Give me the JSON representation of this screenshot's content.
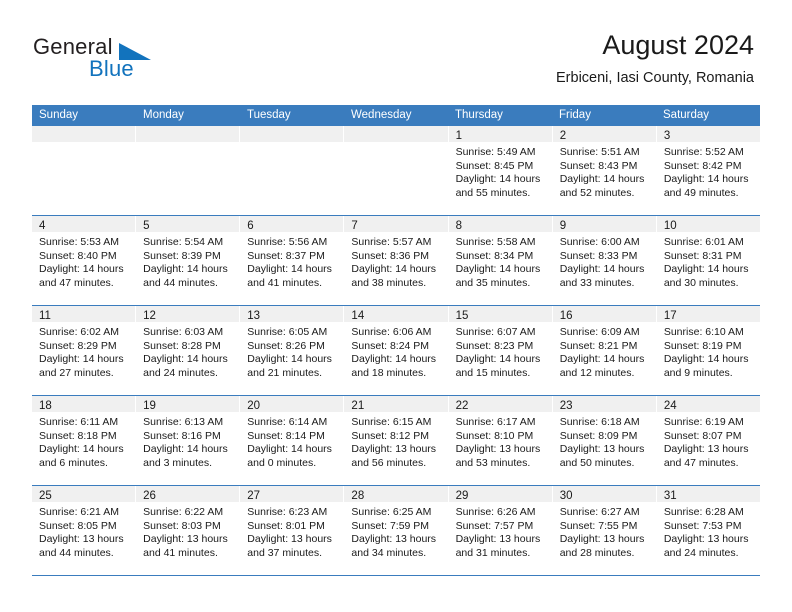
{
  "brand": {
    "name_part1": "General",
    "name_part2": "Blue",
    "triangle_color": "#1273bd"
  },
  "header": {
    "title": "August 2024",
    "subtitle": "Erbiceni, Iasi County, Romania"
  },
  "theme": {
    "header_blue": "#3a7cbe",
    "band_gray": "#f0f0f0",
    "text": "#1a1a1a"
  },
  "weekday_headers": [
    "Sunday",
    "Monday",
    "Tuesday",
    "Wednesday",
    "Thursday",
    "Friday",
    "Saturday"
  ],
  "labels": {
    "sunrise_prefix": "Sunrise: ",
    "sunset_prefix": "Sunset: ",
    "daylight_prefix": "Daylight: "
  },
  "weeks": [
    [
      {
        "day": "",
        "empty": true
      },
      {
        "day": "",
        "empty": true
      },
      {
        "day": "",
        "empty": true
      },
      {
        "day": "",
        "empty": true
      },
      {
        "day": "1",
        "sunrise": "Sunrise: 5:49 AM",
        "sunset": "Sunset: 8:45 PM",
        "daylight_line1": "Daylight: 14 hours",
        "daylight_line2": "and 55 minutes."
      },
      {
        "day": "2",
        "sunrise": "Sunrise: 5:51 AM",
        "sunset": "Sunset: 8:43 PM",
        "daylight_line1": "Daylight: 14 hours",
        "daylight_line2": "and 52 minutes."
      },
      {
        "day": "3",
        "sunrise": "Sunrise: 5:52 AM",
        "sunset": "Sunset: 8:42 PM",
        "daylight_line1": "Daylight: 14 hours",
        "daylight_line2": "and 49 minutes."
      }
    ],
    [
      {
        "day": "4",
        "sunrise": "Sunrise: 5:53 AM",
        "sunset": "Sunset: 8:40 PM",
        "daylight_line1": "Daylight: 14 hours",
        "daylight_line2": "and 47 minutes."
      },
      {
        "day": "5",
        "sunrise": "Sunrise: 5:54 AM",
        "sunset": "Sunset: 8:39 PM",
        "daylight_line1": "Daylight: 14 hours",
        "daylight_line2": "and 44 minutes."
      },
      {
        "day": "6",
        "sunrise": "Sunrise: 5:56 AM",
        "sunset": "Sunset: 8:37 PM",
        "daylight_line1": "Daylight: 14 hours",
        "daylight_line2": "and 41 minutes."
      },
      {
        "day": "7",
        "sunrise": "Sunrise: 5:57 AM",
        "sunset": "Sunset: 8:36 PM",
        "daylight_line1": "Daylight: 14 hours",
        "daylight_line2": "and 38 minutes."
      },
      {
        "day": "8",
        "sunrise": "Sunrise: 5:58 AM",
        "sunset": "Sunset: 8:34 PM",
        "daylight_line1": "Daylight: 14 hours",
        "daylight_line2": "and 35 minutes."
      },
      {
        "day": "9",
        "sunrise": "Sunrise: 6:00 AM",
        "sunset": "Sunset: 8:33 PM",
        "daylight_line1": "Daylight: 14 hours",
        "daylight_line2": "and 33 minutes."
      },
      {
        "day": "10",
        "sunrise": "Sunrise: 6:01 AM",
        "sunset": "Sunset: 8:31 PM",
        "daylight_line1": "Daylight: 14 hours",
        "daylight_line2": "and 30 minutes."
      }
    ],
    [
      {
        "day": "11",
        "sunrise": "Sunrise: 6:02 AM",
        "sunset": "Sunset: 8:29 PM",
        "daylight_line1": "Daylight: 14 hours",
        "daylight_line2": "and 27 minutes."
      },
      {
        "day": "12",
        "sunrise": "Sunrise: 6:03 AM",
        "sunset": "Sunset: 8:28 PM",
        "daylight_line1": "Daylight: 14 hours",
        "daylight_line2": "and 24 minutes."
      },
      {
        "day": "13",
        "sunrise": "Sunrise: 6:05 AM",
        "sunset": "Sunset: 8:26 PM",
        "daylight_line1": "Daylight: 14 hours",
        "daylight_line2": "and 21 minutes."
      },
      {
        "day": "14",
        "sunrise": "Sunrise: 6:06 AM",
        "sunset": "Sunset: 8:24 PM",
        "daylight_line1": "Daylight: 14 hours",
        "daylight_line2": "and 18 minutes."
      },
      {
        "day": "15",
        "sunrise": "Sunrise: 6:07 AM",
        "sunset": "Sunset: 8:23 PM",
        "daylight_line1": "Daylight: 14 hours",
        "daylight_line2": "and 15 minutes."
      },
      {
        "day": "16",
        "sunrise": "Sunrise: 6:09 AM",
        "sunset": "Sunset: 8:21 PM",
        "daylight_line1": "Daylight: 14 hours",
        "daylight_line2": "and 12 minutes."
      },
      {
        "day": "17",
        "sunrise": "Sunrise: 6:10 AM",
        "sunset": "Sunset: 8:19 PM",
        "daylight_line1": "Daylight: 14 hours",
        "daylight_line2": "and 9 minutes."
      }
    ],
    [
      {
        "day": "18",
        "sunrise": "Sunrise: 6:11 AM",
        "sunset": "Sunset: 8:18 PM",
        "daylight_line1": "Daylight: 14 hours",
        "daylight_line2": "and 6 minutes."
      },
      {
        "day": "19",
        "sunrise": "Sunrise: 6:13 AM",
        "sunset": "Sunset: 8:16 PM",
        "daylight_line1": "Daylight: 14 hours",
        "daylight_line2": "and 3 minutes."
      },
      {
        "day": "20",
        "sunrise": "Sunrise: 6:14 AM",
        "sunset": "Sunset: 8:14 PM",
        "daylight_line1": "Daylight: 14 hours",
        "daylight_line2": "and 0 minutes."
      },
      {
        "day": "21",
        "sunrise": "Sunrise: 6:15 AM",
        "sunset": "Sunset: 8:12 PM",
        "daylight_line1": "Daylight: 13 hours",
        "daylight_line2": "and 56 minutes."
      },
      {
        "day": "22",
        "sunrise": "Sunrise: 6:17 AM",
        "sunset": "Sunset: 8:10 PM",
        "daylight_line1": "Daylight: 13 hours",
        "daylight_line2": "and 53 minutes."
      },
      {
        "day": "23",
        "sunrise": "Sunrise: 6:18 AM",
        "sunset": "Sunset: 8:09 PM",
        "daylight_line1": "Daylight: 13 hours",
        "daylight_line2": "and 50 minutes."
      },
      {
        "day": "24",
        "sunrise": "Sunrise: 6:19 AM",
        "sunset": "Sunset: 8:07 PM",
        "daylight_line1": "Daylight: 13 hours",
        "daylight_line2": "and 47 minutes."
      }
    ],
    [
      {
        "day": "25",
        "sunrise": "Sunrise: 6:21 AM",
        "sunset": "Sunset: 8:05 PM",
        "daylight_line1": "Daylight: 13 hours",
        "daylight_line2": "and 44 minutes."
      },
      {
        "day": "26",
        "sunrise": "Sunrise: 6:22 AM",
        "sunset": "Sunset: 8:03 PM",
        "daylight_line1": "Daylight: 13 hours",
        "daylight_line2": "and 41 minutes."
      },
      {
        "day": "27",
        "sunrise": "Sunrise: 6:23 AM",
        "sunset": "Sunset: 8:01 PM",
        "daylight_line1": "Daylight: 13 hours",
        "daylight_line2": "and 37 minutes."
      },
      {
        "day": "28",
        "sunrise": "Sunrise: 6:25 AM",
        "sunset": "Sunset: 7:59 PM",
        "daylight_line1": "Daylight: 13 hours",
        "daylight_line2": "and 34 minutes."
      },
      {
        "day": "29",
        "sunrise": "Sunrise: 6:26 AM",
        "sunset": "Sunset: 7:57 PM",
        "daylight_line1": "Daylight: 13 hours",
        "daylight_line2": "and 31 minutes."
      },
      {
        "day": "30",
        "sunrise": "Sunrise: 6:27 AM",
        "sunset": "Sunset: 7:55 PM",
        "daylight_line1": "Daylight: 13 hours",
        "daylight_line2": "and 28 minutes."
      },
      {
        "day": "31",
        "sunrise": "Sunrise: 6:28 AM",
        "sunset": "Sunset: 7:53 PM",
        "daylight_line1": "Daylight: 13 hours",
        "daylight_line2": "and 24 minutes."
      }
    ]
  ]
}
